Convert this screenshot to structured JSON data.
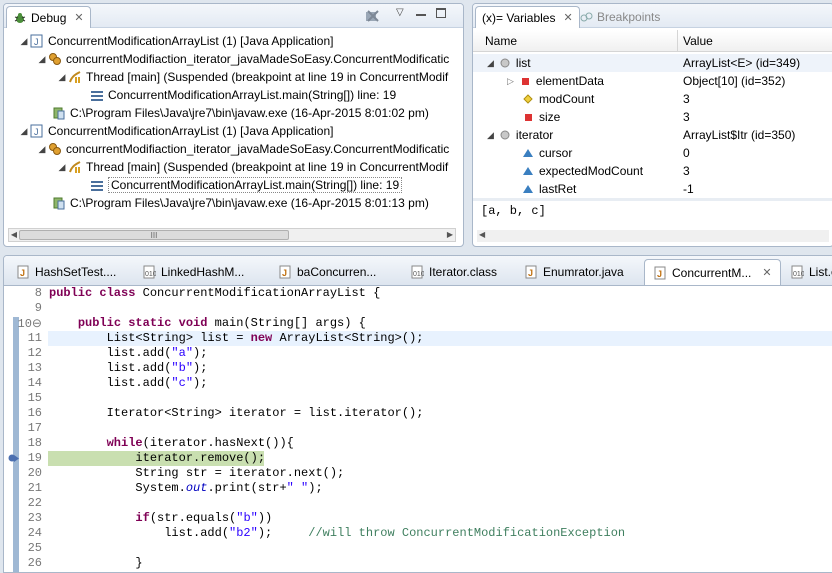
{
  "debug": {
    "tab_label": "Debug",
    "tree": [
      {
        "text": "ConcurrentModificationArrayList (1) [Java Application]",
        "icon": "java-app-icon"
      },
      {
        "text": "concurrentModifiaction_iterator_javaMadeSoEasy.ConcurrentModificatic",
        "icon": "debug-target-icon"
      },
      {
        "text": "Thread [main] (Suspended (breakpoint at line 19 in ConcurrentModif",
        "icon": "thread-suspended-icon"
      },
      {
        "text": "ConcurrentModificationArrayList.main(String[]) line: 19",
        "icon": "stack-frame-icon"
      },
      {
        "text": "C:\\Program Files\\Java\\jre7\\bin\\javaw.exe (16-Apr-2015 8:01:02 pm)",
        "icon": "process-icon"
      },
      {
        "text": "ConcurrentModificationArrayList (1) [Java Application]",
        "icon": "java-app-icon"
      },
      {
        "text": "concurrentModifiaction_iterator_javaMadeSoEasy.ConcurrentModificatic",
        "icon": "debug-target-icon"
      },
      {
        "text": "Thread [main] (Suspended (breakpoint at line 19 in ConcurrentModif",
        "icon": "thread-suspended-icon"
      },
      {
        "text": "ConcurrentModificationArrayList.main(String[]) line: 19",
        "icon": "stack-frame-icon"
      },
      {
        "text": "C:\\Program Files\\Java\\jre7\\bin\\javaw.exe (16-Apr-2015 8:01:13 pm)",
        "icon": "process-icon"
      }
    ],
    "scroll_thumb": "III"
  },
  "variables": {
    "tab_label": "(x)= Variables",
    "breakpoints_label": "Breakpoints",
    "col_name": "Name",
    "col_value": "Value",
    "rows": [
      {
        "name": "list",
        "value": "ArrayList<E>  (id=349)",
        "icon": "local-variable-icon"
      },
      {
        "name": "elementData",
        "value": "Object[10]  (id=352)",
        "icon": "private-field-icon"
      },
      {
        "name": "modCount",
        "value": "3",
        "icon": "protected-field-icon"
      },
      {
        "name": "size",
        "value": "3",
        "icon": "private-field-icon"
      },
      {
        "name": "iterator",
        "value": "ArrayList$Itr  (id=350)",
        "icon": "local-variable-icon"
      },
      {
        "name": "cursor",
        "value": "0",
        "icon": "default-field-icon"
      },
      {
        "name": "expectedModCount",
        "value": "3",
        "icon": "default-field-icon"
      },
      {
        "name": "lastRet",
        "value": "-1",
        "icon": "default-field-icon"
      }
    ],
    "detail": "[a, b, c]"
  },
  "editor": {
    "tabs": [
      {
        "label": "HashSetTest....",
        "icon": "java-file-icon"
      },
      {
        "label": "LinkedHashM...",
        "icon": "class-file-icon"
      },
      {
        "label": "baConcurren...",
        "icon": "java-file-icon"
      },
      {
        "label": "Iterator.class",
        "icon": "class-file-icon"
      },
      {
        "label": "Enumrator.java",
        "icon": "java-file-icon"
      },
      {
        "label": "ConcurrentM...",
        "icon": "java-file-icon"
      },
      {
        "label": "List.cl",
        "icon": "class-file-icon"
      }
    ],
    "lines": [
      {
        "n": "8",
        "segs": [
          [
            "kw",
            "public class "
          ],
          [
            "",
            "ConcurrentModificationArrayList {"
          ]
        ]
      },
      {
        "n": "9",
        "segs": []
      },
      {
        "n": "10⊖",
        "segs": [
          [
            "",
            "    "
          ],
          [
            "kw",
            "public static void "
          ],
          [
            "",
            "main(String[] args) {"
          ]
        ]
      },
      {
        "n": "11",
        "segs": [
          [
            "",
            "        List<String> list = "
          ],
          [
            "kw",
            "new "
          ],
          [
            "",
            "ArrayList<String>();"
          ]
        ]
      },
      {
        "n": "12",
        "segs": [
          [
            "",
            "        list.add("
          ],
          [
            "str",
            "\"a\""
          ],
          [
            "",
            ");"
          ]
        ]
      },
      {
        "n": "13",
        "segs": [
          [
            "",
            "        list.add("
          ],
          [
            "str",
            "\"b\""
          ],
          [
            "",
            ");"
          ]
        ]
      },
      {
        "n": "14",
        "segs": [
          [
            "",
            "        list.add("
          ],
          [
            "str",
            "\"c\""
          ],
          [
            "",
            ");"
          ]
        ]
      },
      {
        "n": "15",
        "segs": []
      },
      {
        "n": "16",
        "segs": [
          [
            "",
            "        Iterator<String> iterator = list.iterator();"
          ]
        ]
      },
      {
        "n": "17",
        "segs": []
      },
      {
        "n": "18",
        "segs": [
          [
            "",
            "        "
          ],
          [
            "kw",
            "while"
          ],
          [
            "",
            "(iterator.hasNext()){"
          ]
        ]
      },
      {
        "n": "19",
        "segs": [
          [
            "",
            "            iterator.remove();"
          ]
        ]
      },
      {
        "n": "20",
        "segs": [
          [
            "",
            "            String str = iterator.next();"
          ]
        ]
      },
      {
        "n": "21",
        "segs": [
          [
            "",
            "            System."
          ],
          [
            "fld",
            "out"
          ],
          [
            "",
            ".print(str+"
          ],
          [
            "str",
            "\" \""
          ],
          [
            "",
            ");"
          ]
        ]
      },
      {
        "n": "22",
        "segs": []
      },
      {
        "n": "23",
        "segs": [
          [
            "",
            "            "
          ],
          [
            "kw",
            "if"
          ],
          [
            "",
            "(str.equals("
          ],
          [
            "str",
            "\"b\""
          ],
          [
            "",
            "))"
          ]
        ]
      },
      {
        "n": "24",
        "segs": [
          [
            "",
            "                list.add("
          ],
          [
            "str",
            "\"b2\""
          ],
          [
            "",
            ");     "
          ],
          [
            "cm",
            "//will throw ConcurrentModificationException"
          ]
        ]
      },
      {
        "n": "25",
        "segs": []
      },
      {
        "n": "26",
        "segs": [
          [
            "",
            "            }"
          ]
        ]
      }
    ]
  }
}
